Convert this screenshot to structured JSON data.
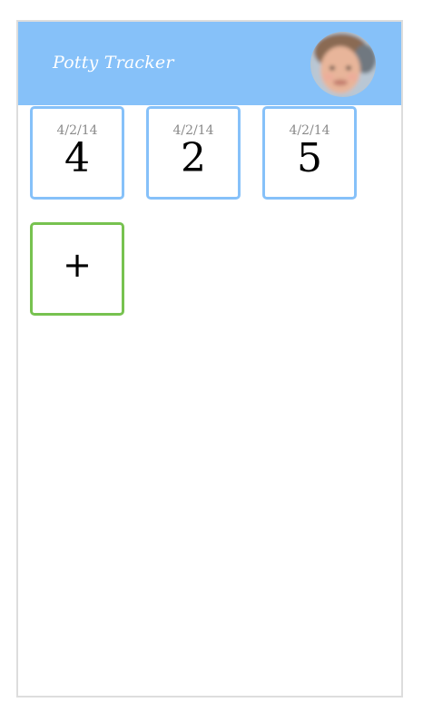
{
  "app": {
    "title": "Potty Tracker"
  },
  "entries": [
    {
      "date": "4/2/14",
      "count": "4"
    },
    {
      "date": "4/2/14",
      "count": "2"
    },
    {
      "date": "4/2/14",
      "count": "5"
    }
  ],
  "add_button": {
    "label": "+"
  },
  "colors": {
    "header": "#86c1f9",
    "entry_border": "#86c1f9",
    "add_border": "#77c250"
  },
  "icons": {
    "avatar": "child-avatar-photo",
    "add": "plus-icon"
  }
}
